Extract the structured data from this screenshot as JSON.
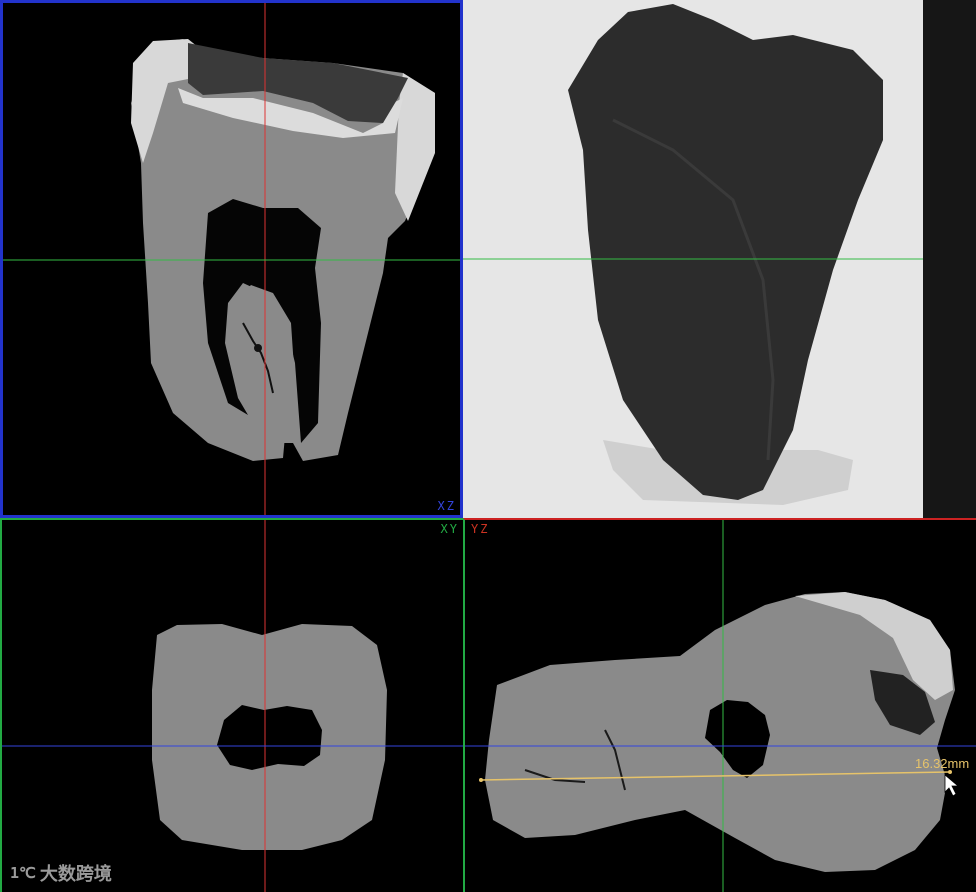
{
  "viewports": {
    "xz": {
      "label": "XZ",
      "label_color": "#3344dd"
    },
    "xy": {
      "label": "XY",
      "label_color": "#22aa44"
    },
    "yz": {
      "label": "YZ",
      "label_color": "#cc3322"
    }
  },
  "measurement": {
    "value": "16.32mm"
  },
  "watermark": {
    "logo": "1℃",
    "text": "大数跨境"
  },
  "colors": {
    "axis_red": "#dd3333",
    "axis_green": "#33bb44",
    "axis_blue": "#3344dd",
    "measure_line": "#e6c36a"
  }
}
